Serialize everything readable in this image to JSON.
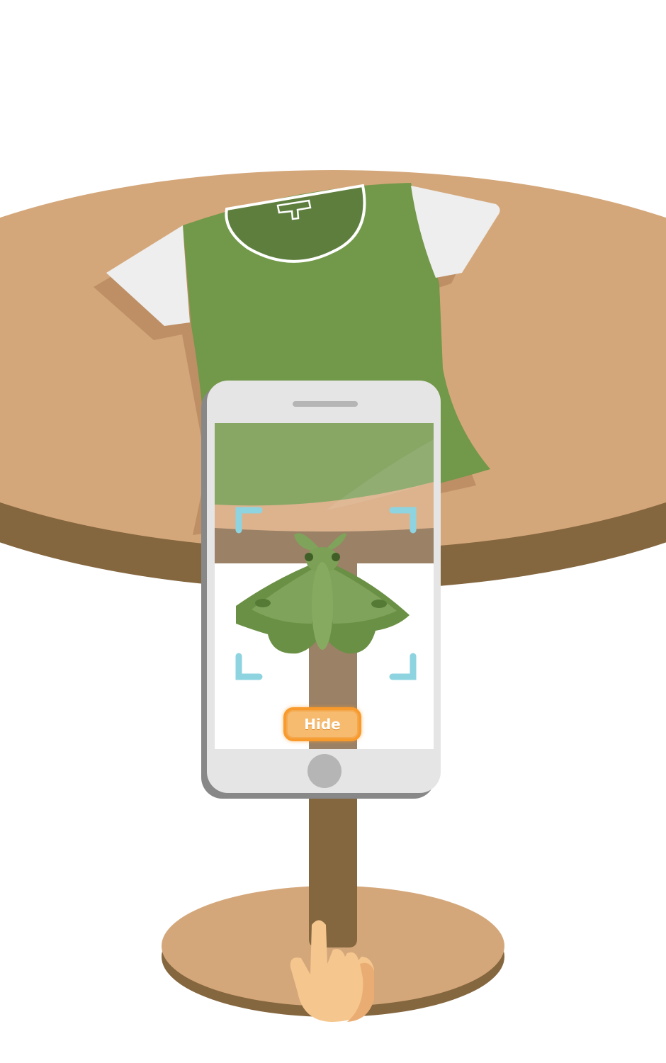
{
  "scene": {
    "description_colors": {
      "table_top": "#D4A77A",
      "table_rim": "#84663F",
      "shirt": "#729849",
      "sleeve": "#EEEEEE",
      "phone_body": "#E5E5E5",
      "scanner_corner": "#8DD3E0",
      "button_accent": "#F89A2C",
      "hand": "#F5C68E"
    },
    "icons": [
      "moth",
      "tshirt",
      "phone",
      "pointing-hand",
      "scan-frame"
    ]
  },
  "phone": {
    "hide_button_label": "Hide"
  }
}
